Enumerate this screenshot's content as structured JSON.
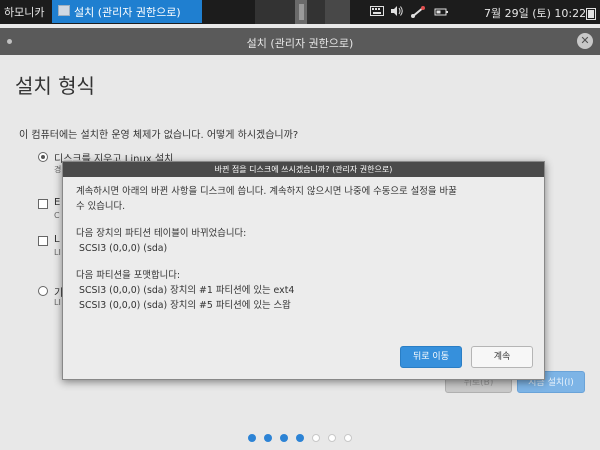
{
  "panel": {
    "menu_label": "하모니카",
    "task_label": "설치 (관리자 권한으로)",
    "clock": "7월 29일 (토) 10:22"
  },
  "window": {
    "title": "설치 (관리자 권한으로)",
    "page_title": "설치 형식",
    "question": "이 컴퓨터에는 설치한 운영 체제가 없습니다. 어떻게 하시겠습니까?",
    "options": [
      {
        "label": "디스크를 지우고 Linux 설치",
        "desc": "경",
        "type": "radio",
        "checked": true
      },
      {
        "label": "E",
        "desc": "C",
        "type": "checkbox",
        "checked": false
      },
      {
        "label": "L",
        "desc": "LI",
        "type": "checkbox",
        "checked": false
      },
      {
        "label": "기",
        "desc": "LI",
        "type": "radio",
        "checked": false
      }
    ],
    "back_label": "뒤로(B)",
    "install_label": "지금 설치(I)",
    "progress_dots": {
      "total": 7,
      "active": 4
    }
  },
  "dialog": {
    "title": "바뀐 점을 디스크에 쓰시겠습니까? (관리자 권한으로)",
    "intro_line1": "계속하시면 아래의 바뀐 사항을 디스크에 씁니다. 계속하지 않으시면 나중에 수동으로 설정을 바꿀",
    "intro_line2": "수 있습니다.",
    "partition_table_header": "다음 장치의 파티션 테이블이 바뀌었습니다:",
    "partition_table_device": "SCSI3 (0,0,0) (sda)",
    "format_header": "다음 파티션을 포맷합니다:",
    "format_items": [
      "SCSI3 (0,0,0) (sda) 장치의 #1 파티션에 있는 ext4",
      "SCSI3 (0,0,0) (sda) 장치의 #5 파티션에 있는 스왑"
    ],
    "back_label": "뒤로 이동",
    "continue_label": "계속"
  },
  "colors": {
    "accent": "#3690dc",
    "panel_bg": "#1c1c1c",
    "taskbar_active": "#1f7fd0",
    "titlebar_bg": "#5a5a5a"
  },
  "icons": [
    "window-icon",
    "keyboard-icon",
    "volume-icon",
    "network-icon",
    "power-icon",
    "logout-icon",
    "close-icon"
  ]
}
